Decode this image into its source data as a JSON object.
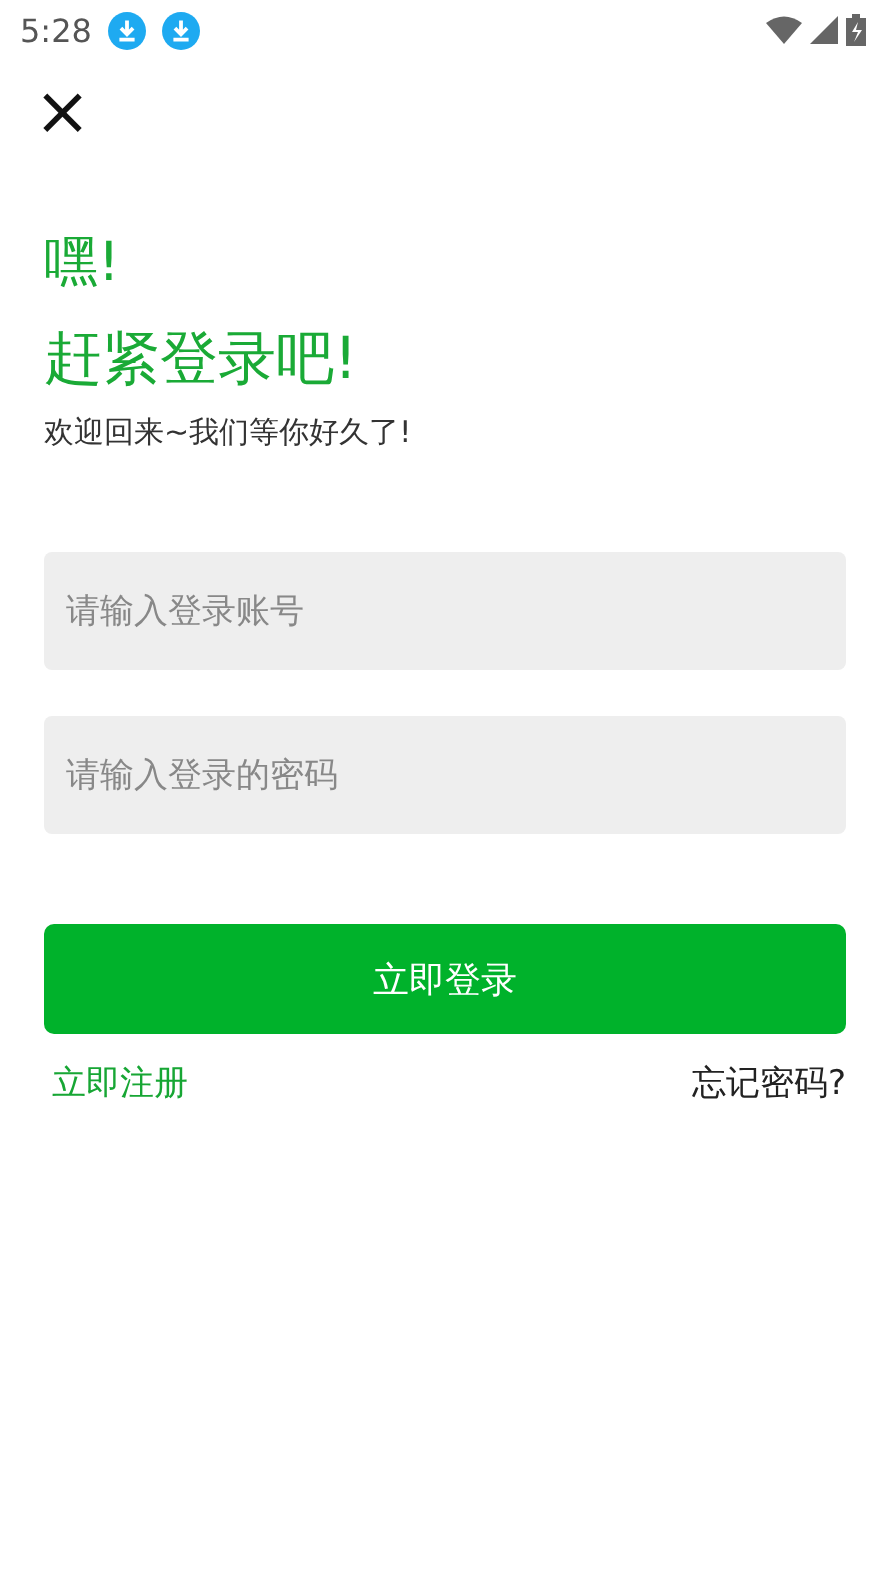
{
  "status_bar": {
    "time": "5:28",
    "notifications": [
      {
        "kind": "download"
      },
      {
        "kind": "download"
      }
    ]
  },
  "close_button": {
    "label": "×"
  },
  "greeting": "嘿!",
  "headline": "赶紧登录吧!",
  "subtitle": "欢迎回来~我们等你好久了!",
  "fields": [
    {
      "placeholder": "请输入登录账号"
    },
    {
      "placeholder": "请输入登录的密码"
    }
  ],
  "login_button": "立即登录",
  "register_link": "立即注册",
  "forgot_link": "忘记密码?"
}
